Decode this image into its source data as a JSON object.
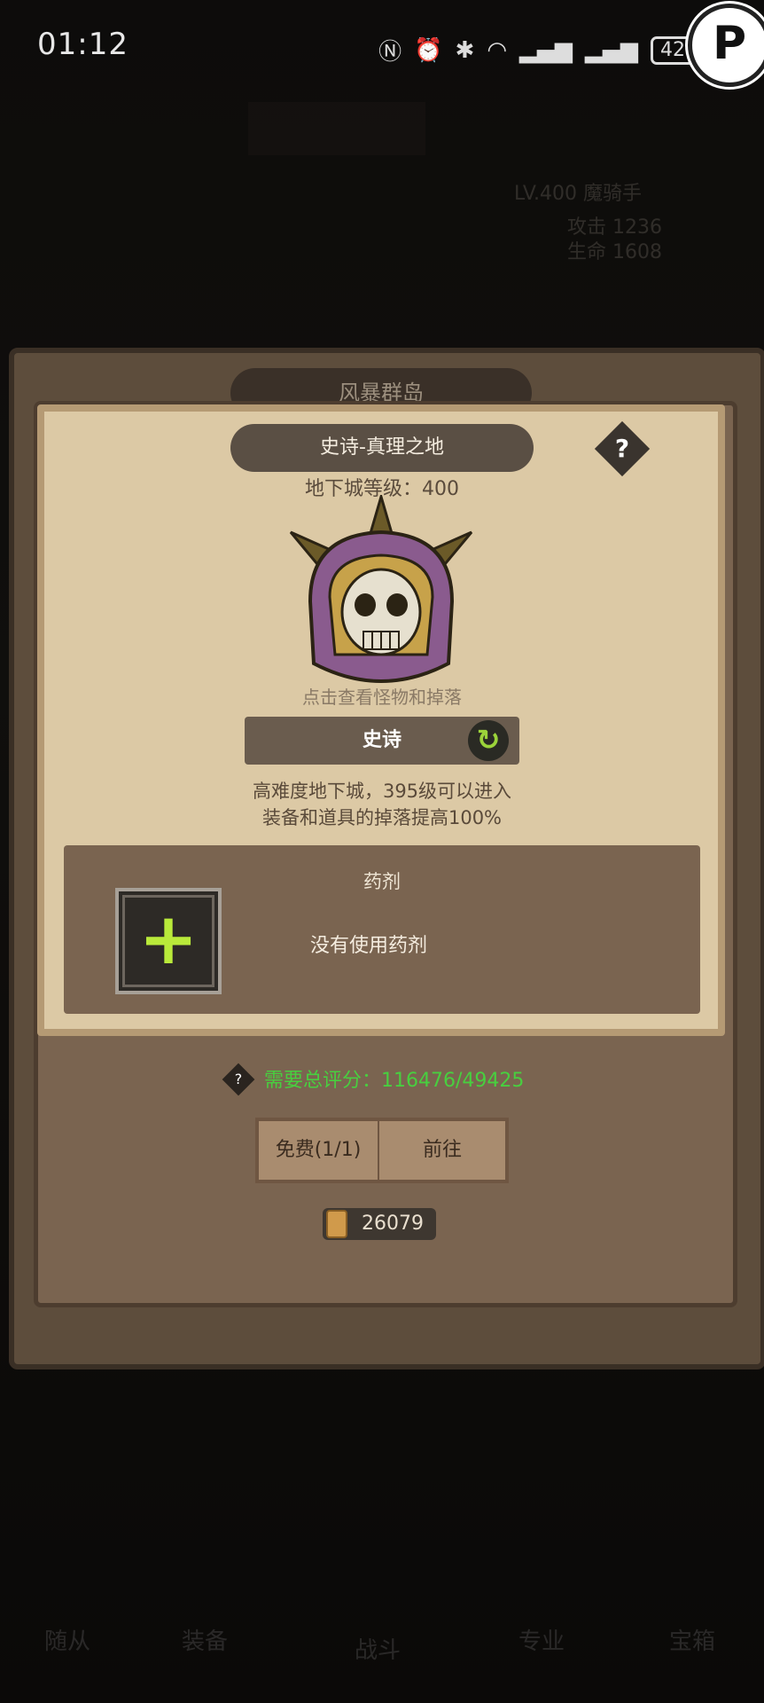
{
  "status_bar": {
    "time": "01:12",
    "battery": "42",
    "corner_badge": "P"
  },
  "background": {
    "region_title": "风暴群岛",
    "player_level": "LV.400 魔骑手",
    "stat_1": "攻击 1236",
    "stat_2": "生命 1608",
    "bottom_nav": [
      "随从",
      "装备",
      "战斗",
      "专业",
      "宝箱"
    ]
  },
  "dialog": {
    "title": "史诗-真理之地",
    "help_label": "?",
    "dungeon_level": "地下城等级：400",
    "monster_hint": "点击查看怪物和掉落",
    "difficulty": "史诗",
    "refresh_icon": "↻",
    "description_line_1": "高难度地下城，395级可以进入",
    "description_line_2": "装备和道具的掉落提高100%",
    "potion": {
      "title": "药剂",
      "add_symbol": "+",
      "status": "没有使用药剂"
    },
    "score_help": "?",
    "score": "需要总评分：116476/49425",
    "free_button": "免费(1/1)",
    "go_button": "前往",
    "scroll_count": "26079"
  },
  "colors": {
    "parchment": "#dcc9a5",
    "score_green": "#48cf3f",
    "plus_green": "#b9ea3a"
  }
}
